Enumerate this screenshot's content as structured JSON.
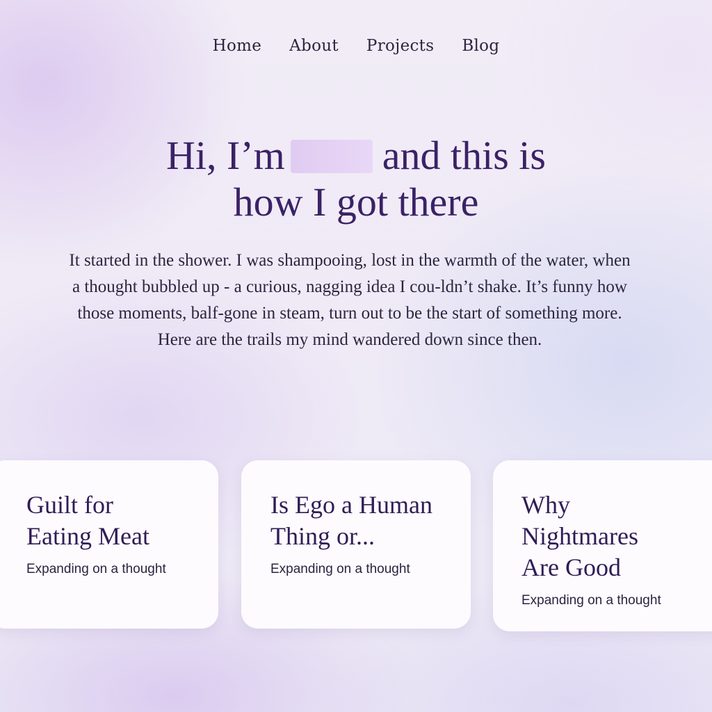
{
  "nav": {
    "items": [
      {
        "label": "Home"
      },
      {
        "label": "About"
      },
      {
        "label": "Projects"
      },
      {
        "label": "Blog"
      }
    ]
  },
  "hero": {
    "title_part1": "Hi, I’m",
    "title_part2": "and this is",
    "title_line2": "how I got there",
    "intro": "It started in the shower. I was shampooing, lost in the warmth of the water, when a thought bubbled up - a curious, nagging idea I cou-ldn’t shake. It’s funny how those moments, balf-gone in steam, turn out to be the start of something more. Here are the trails my mind wandered down since then."
  },
  "cards": [
    {
      "title": "Guilt for Eating Meat",
      "subtitle": "Expanding on a thought"
    },
    {
      "title": "Is Ego a Human Thing or...",
      "subtitle": "Expanding on a thought"
    },
    {
      "title": "Why Nightmares Are Good",
      "subtitle": "Expanding on a thought"
    }
  ],
  "colors": {
    "heading": "#3a2266",
    "text": "#2b2540",
    "card_bg": "#fdfbfe",
    "redaction": "#e2ccf2"
  }
}
